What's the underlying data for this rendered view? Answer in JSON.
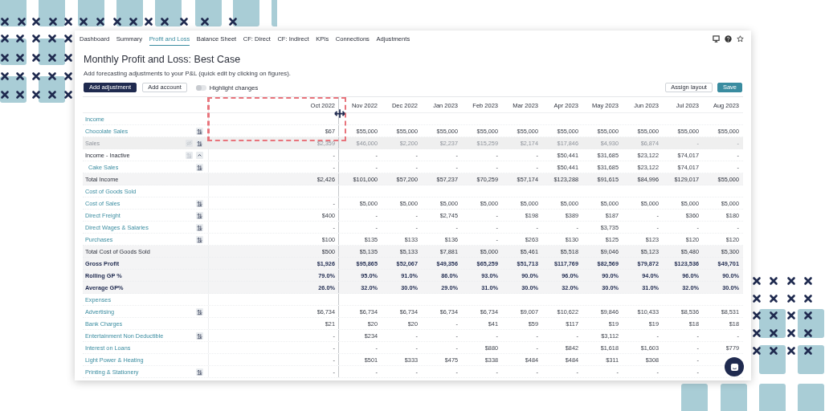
{
  "nav": {
    "tabs": [
      {
        "label": "Dashboard",
        "selected": false
      },
      {
        "label": "Summary",
        "selected": false
      },
      {
        "label": "Profit and Loss",
        "selected": true
      },
      {
        "label": "Balance Sheet",
        "selected": false
      },
      {
        "label": "CF: Direct",
        "selected": false
      },
      {
        "label": "CF: Indirect",
        "selected": false
      },
      {
        "label": "KPIs",
        "selected": false
      },
      {
        "label": "Connections",
        "selected": false
      },
      {
        "label": "Adjustments",
        "selected": false
      }
    ]
  },
  "title": "Monthly Profit and Loss: Best Case",
  "subtitle": "Add forecasting adjustments to your P&L (quick edit by clicking on figures).",
  "toolbar": {
    "add_adjustment": "Add adjustment",
    "add_account": "Add account",
    "highlight": {
      "label": "Highlight changes",
      "on": false
    },
    "assign_layout": "Assign layout",
    "save": "Save"
  },
  "table": {
    "columns": [
      "Oct 2022",
      "Nov 2022",
      "Dec 2022",
      "Jan 2023",
      "Feb 2023",
      "Mar 2023",
      "Apr 2023",
      "May 2023",
      "Jun 2023",
      "Jul 2023",
      "Aug 2023"
    ],
    "rows": [
      {
        "label": "Income",
        "kind": "section",
        "values": []
      },
      {
        "label": "Chocolate Sales",
        "kind": "account",
        "adjustable": true,
        "values": [
          "$67",
          "$55,000",
          "$55,000",
          "$55,000",
          "$55,000",
          "$55,000",
          "$55,000",
          "$55,000",
          "$55,000",
          "$55,000",
          "$55,000"
        ]
      },
      {
        "label": "Sales",
        "kind": "hidden",
        "adjustable": true,
        "values": [
          "$2,359",
          "$46,000",
          "$2,200",
          "$2,237",
          "$15,259",
          "$2,174",
          "$17,846",
          "$4,930",
          "$6,874",
          "-",
          "-"
        ]
      },
      {
        "label": "Income - Inactive",
        "kind": "group",
        "values": [
          "-",
          "-",
          "-",
          "-",
          "-",
          "-",
          "$50,441",
          "$31,685",
          "$23,122",
          "$74,017",
          "-"
        ]
      },
      {
        "label": "Cake Sales",
        "kind": "child",
        "adjustable": true,
        "values": [
          "-",
          "-",
          "-",
          "-",
          "-",
          "-",
          "$50,441",
          "$31,685",
          "$23,122",
          "$74,017",
          "-"
        ]
      },
      {
        "label": "Total Income",
        "kind": "total",
        "values": [
          "$2,426",
          "$101,000",
          "$57,200",
          "$57,237",
          "$70,259",
          "$57,174",
          "$123,288",
          "$91,615",
          "$84,996",
          "$129,017",
          "$55,000"
        ]
      },
      {
        "label": "Cost of Goods Sold",
        "kind": "section",
        "values": []
      },
      {
        "label": "Cost of Sales",
        "kind": "account",
        "adjustable": true,
        "values": [
          "-",
          "$5,000",
          "$5,000",
          "$5,000",
          "$5,000",
          "$5,000",
          "$5,000",
          "$5,000",
          "$5,000",
          "$5,000",
          "$5,000"
        ]
      },
      {
        "label": "Direct Freight",
        "kind": "account",
        "adjustable": true,
        "values": [
          "$400",
          "-",
          "-",
          "$2,745",
          "-",
          "$198",
          "$389",
          "$187",
          "-",
          "$360",
          "$180"
        ]
      },
      {
        "label": "Direct Wages & Salaries",
        "kind": "account",
        "adjustable": true,
        "values": [
          "-",
          "-",
          "-",
          "-",
          "-",
          "-",
          "-",
          "$3,735",
          "-",
          "-",
          "-"
        ]
      },
      {
        "label": "Purchases",
        "kind": "account",
        "adjustable": true,
        "values": [
          "$100",
          "$135",
          "$133",
          "$136",
          "-",
          "$263",
          "$130",
          "$125",
          "$123",
          "$120",
          "$120"
        ]
      },
      {
        "label": "Total Cost of Goods Sold",
        "kind": "total",
        "values": [
          "$500",
          "$5,135",
          "$5,133",
          "$7,881",
          "$5,000",
          "$5,461",
          "$5,518",
          "$9,046",
          "$5,123",
          "$5,480",
          "$5,300"
        ]
      },
      {
        "label": "Gross Profit",
        "kind": "strong",
        "values": [
          "$1,926",
          "$95,865",
          "$52,067",
          "$49,356",
          "$65,259",
          "$51,713",
          "$117,769",
          "$82,569",
          "$79,872",
          "$123,536",
          "$49,701"
        ]
      },
      {
        "label": "Rolling GP %",
        "kind": "strong",
        "values": [
          "79.0%",
          "95.0%",
          "91.0%",
          "86.0%",
          "93.0%",
          "90.0%",
          "96.0%",
          "90.0%",
          "94.0%",
          "96.0%",
          "90.0%"
        ]
      },
      {
        "label": "Average GP%",
        "kind": "strong",
        "values": [
          "26.0%",
          "32.0%",
          "30.0%",
          "29.0%",
          "31.0%",
          "30.0%",
          "32.0%",
          "30.0%",
          "31.0%",
          "32.0%",
          "30.0%"
        ]
      },
      {
        "label": "Expenses",
        "kind": "section",
        "values": []
      },
      {
        "label": "Advertising",
        "kind": "account",
        "adjustable": true,
        "values": [
          "$6,734",
          "$6,734",
          "$6,734",
          "$6,734",
          "$6,734",
          "$9,007",
          "$10,622",
          "$9,846",
          "$10,433",
          "$8,536",
          "$8,531"
        ]
      },
      {
        "label": "Bank Charges",
        "kind": "account",
        "adjustable": false,
        "values": [
          "$21",
          "$20",
          "$20",
          "-",
          "$41",
          "$59",
          "$117",
          "$19",
          "$19",
          "$18",
          "$18"
        ]
      },
      {
        "label": "Entertainment Non Deductible",
        "kind": "account",
        "adjustable": true,
        "values": [
          "-",
          "$234",
          "-",
          "-",
          "-",
          "-",
          "-",
          "$3,112",
          "-",
          "-",
          "-"
        ]
      },
      {
        "label": "Interest on Loans",
        "kind": "account",
        "adjustable": false,
        "values": [
          "-",
          "-",
          "-",
          "-",
          "$880",
          "-",
          "$842",
          "$1,618",
          "$1,603",
          "-",
          "$779"
        ]
      },
      {
        "label": "Light Power & Heating",
        "kind": "account",
        "adjustable": false,
        "values": [
          "-",
          "$501",
          "$333",
          "$475",
          "$338",
          "$484",
          "$484",
          "$311",
          "$308",
          "-"
        ]
      },
      {
        "label": "Printing & Stationery",
        "kind": "account",
        "adjustable": true,
        "values": [
          "-",
          "-",
          "-",
          "-",
          "-",
          "-",
          "-",
          "-",
          "-",
          "-"
        ]
      }
    ]
  }
}
